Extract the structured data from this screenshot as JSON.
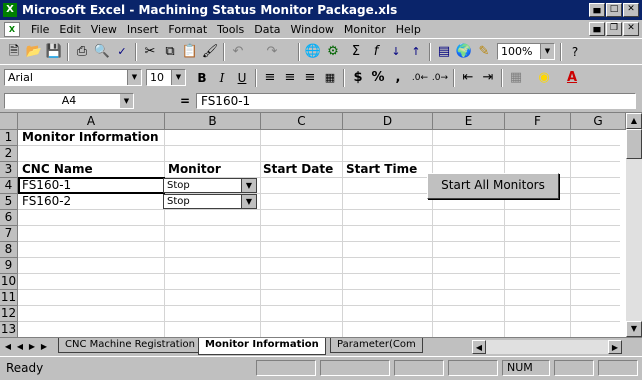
{
  "window": {
    "title": "Microsoft Excel - Machining Status Monitor Package.xls",
    "app_icon": "X"
  },
  "menu": [
    "File",
    "Edit",
    "View",
    "Insert",
    "Format",
    "Tools",
    "Data",
    "Window",
    "Monitor",
    "Help"
  ],
  "toolbar": {
    "zoom": "100%",
    "font": "Arial",
    "font_size": "10",
    "currency": "$",
    "percent": "%",
    "comma": ","
  },
  "formula_bar": {
    "cell_ref": "A4",
    "equals": "=",
    "content": "FS160-1"
  },
  "columns": [
    "A",
    "B",
    "C",
    "D",
    "E",
    "F",
    "G"
  ],
  "rows": [
    "1",
    "2",
    "3",
    "4",
    "5",
    "6",
    "7",
    "8",
    "9",
    "10",
    "11",
    "12",
    "13"
  ],
  "sheet": {
    "title": "Monitor Information",
    "headers": {
      "cnc_name": "CNC Name",
      "monitor": "Monitor",
      "start_date": "Start Date",
      "start_time": "Start Time"
    },
    "rows": [
      {
        "cnc_name": "FS160-1",
        "monitor": "Stop"
      },
      {
        "cnc_name": "FS160-2",
        "monitor": "Stop"
      }
    ],
    "start_button": "Start All Monitors"
  },
  "tabs": [
    "CNC Machine Registration",
    "Monitor Information",
    "Parameter(Com"
  ],
  "active_tab": 1,
  "status": {
    "ready": "Ready",
    "num": "NUM"
  }
}
